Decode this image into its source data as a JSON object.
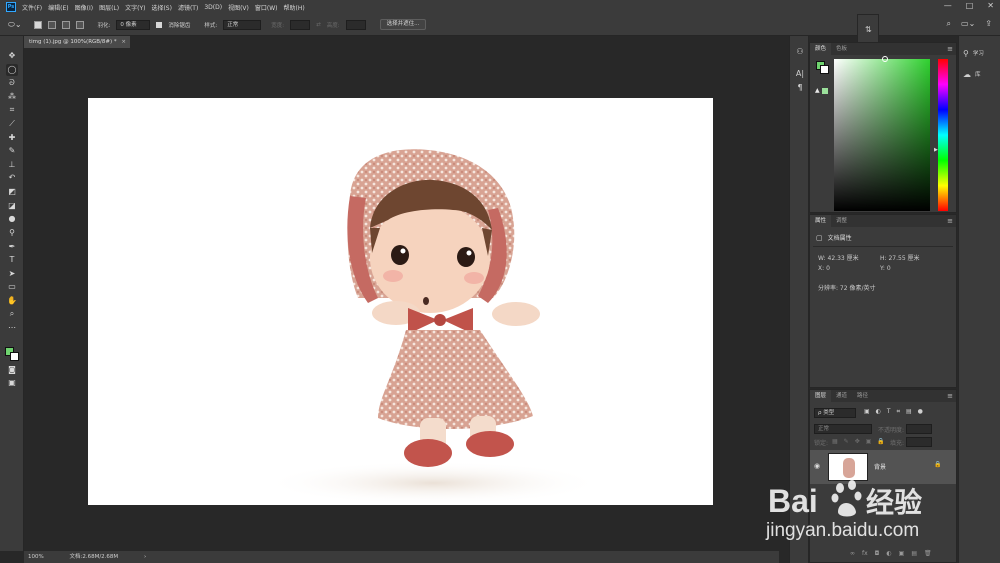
{
  "menubar": {
    "logo": "Ps",
    "items": [
      "文件(F)",
      "编辑(E)",
      "图像(I)",
      "图层(L)",
      "文字(Y)",
      "选择(S)",
      "滤镜(T)",
      "3D(D)",
      "视图(V)",
      "窗口(W)",
      "帮助(H)"
    ],
    "controls": [
      "—",
      "□",
      "✕"
    ]
  },
  "optionsbar": {
    "feather_label": "羽化:",
    "feather_value": "0 像素",
    "antialias_label": "消除锯齿",
    "style_label": "样式:",
    "style_value": "正常",
    "width_label": "宽度:",
    "swap_icon": "⇄",
    "height_label": "高度:",
    "select_mask_button": "选择并遮住..."
  },
  "document": {
    "tab_title": "timg (1).jpg @ 100%(RGB/8#) *",
    "close": "×"
  },
  "statusbar": {
    "zoom": "100%",
    "doc_size": "文档:2.68M/2.68M",
    "arrow": "›"
  },
  "color_panel": {
    "tabs": [
      "颜色",
      "色板"
    ],
    "active_color": "#6fd36f",
    "background_color": "#ffffff",
    "hue_color": "#2fd12f"
  },
  "properties_panel": {
    "tabs": [
      "属性",
      "调整"
    ],
    "section_title": "文档属性",
    "width_label": "W:",
    "width_value": "42.33 厘米",
    "height_label": "H:",
    "height_value": "27.55 厘米",
    "x_label": "X:",
    "x_value": "0",
    "y_label": "Y:",
    "y_value": "0",
    "resolution": "分辨率: 72 像素/英寸"
  },
  "layers_panel": {
    "tabs": [
      "图层",
      "通道",
      "路径"
    ],
    "filter_placeholder": "ρ 类型",
    "blend_mode": "正常",
    "opacity_label": "不透明度:",
    "lock_label": "锁定:",
    "fill_label": "填充:",
    "layer_name": "背景",
    "footer_icons": [
      "∞",
      "fx",
      "◘",
      "◐",
      "▣",
      "▤",
      "🗑"
    ]
  },
  "right_panel": {
    "learn": "学习",
    "library": "库"
  },
  "watermark": {
    "brand": "Bai",
    "brand2": "经验",
    "url": "jingyan.baidu.com"
  }
}
